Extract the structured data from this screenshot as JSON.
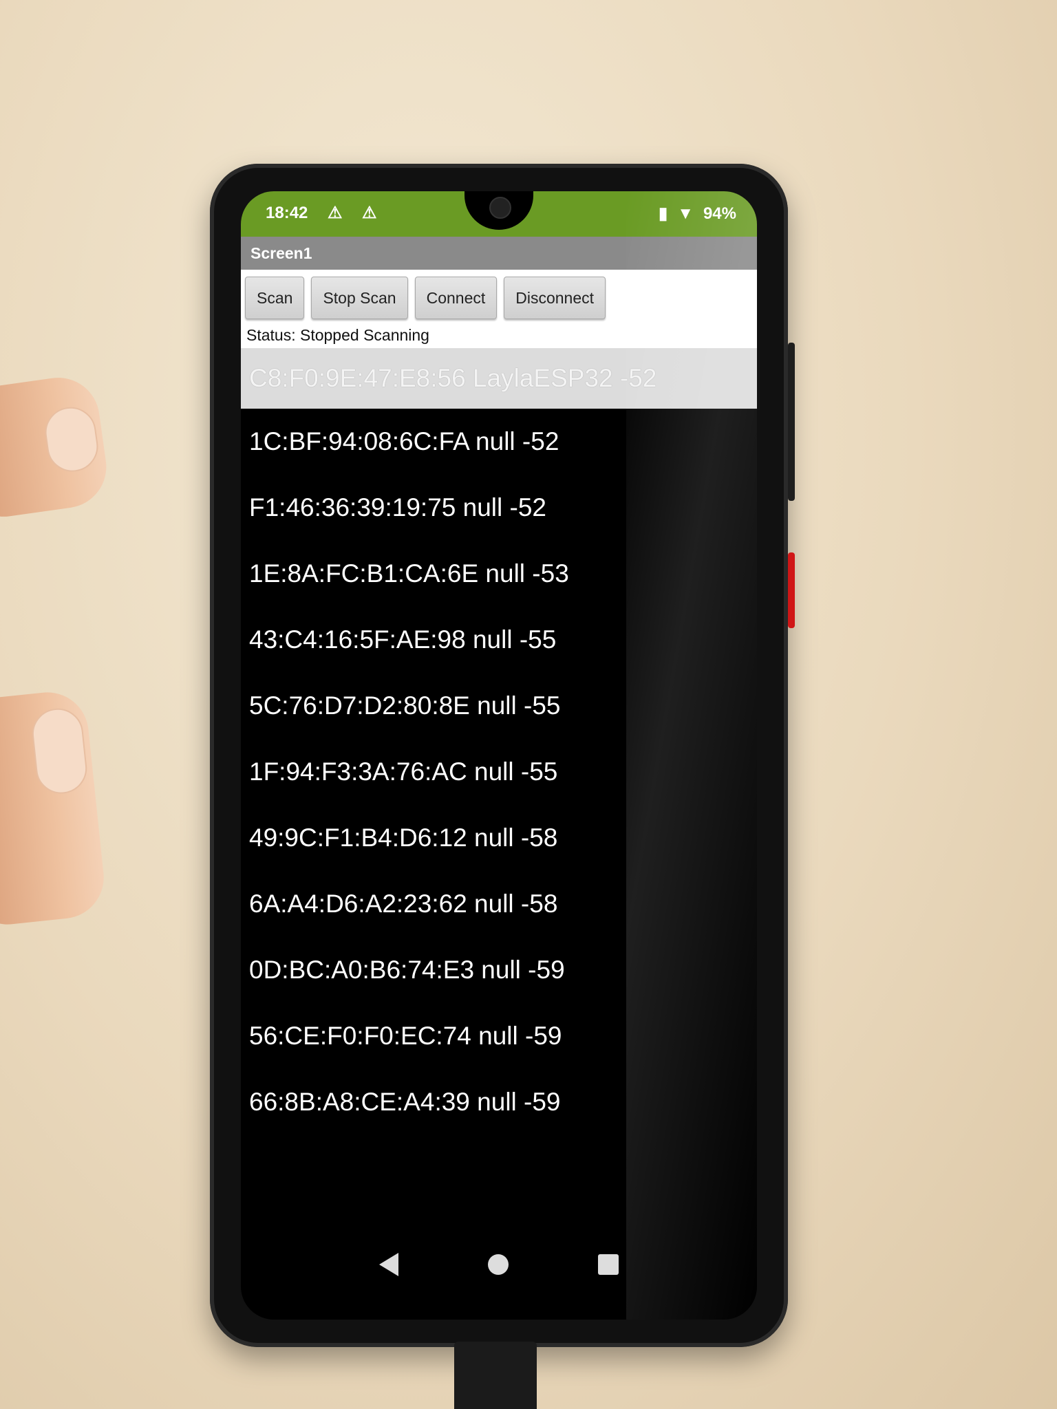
{
  "status_bar": {
    "time": "18:42",
    "warning_icons": [
      "warning-icon",
      "warning-icon"
    ],
    "battery": "94%"
  },
  "app": {
    "screen_title": "Screen1"
  },
  "toolbar": {
    "scan_label": "Scan",
    "stop_scan_label": "Stop Scan",
    "connect_label": "Connect",
    "disconnect_label": "Disconnect"
  },
  "status": {
    "text": "Status: Stopped Scanning"
  },
  "devices": [
    "C8:F0:9E:47:E8:56 LaylaESP32 -52",
    "1C:BF:94:08:6C:FA null -52",
    "F1:46:36:39:19:75 null -52",
    "1E:8A:FC:B1:CA:6E null -53",
    "43:C4:16:5F:AE:98 null -55",
    "5C:76:D7:D2:80:8E null -55",
    "1F:94:F3:3A:76:AC null -55",
    "49:9C:F1:B4:D6:12 null -58",
    "6A:A4:D6:A2:23:62 null -58",
    "0D:BC:A0:B6:74:E3 null -59",
    "56:CE:F0:F0:EC:74 null -59",
    "66:8B:A8:CE:A4:39 null -59"
  ],
  "colors": {
    "status_bar": "#6a9b24",
    "title_bar": "#8a8a8a",
    "selected_row": "#dcdcdc"
  }
}
